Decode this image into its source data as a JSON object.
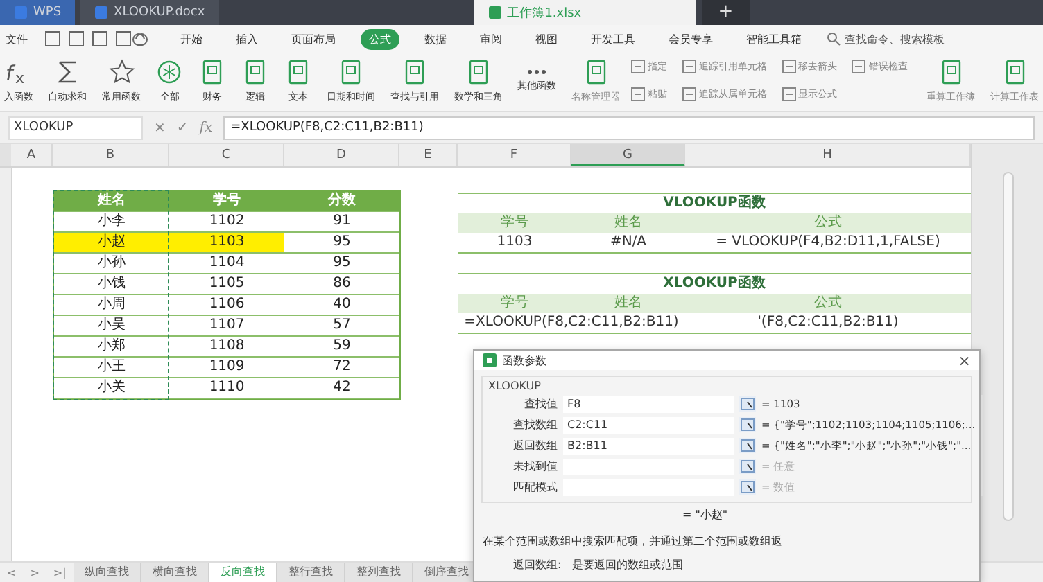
{
  "title_tabs": [
    {
      "label": "WPS",
      "selected": false
    },
    {
      "label": "XLOOKUP.docx",
      "selected": false
    },
    {
      "label": "工作簿1.xlsx",
      "selected": true
    }
  ],
  "new_tab": "+",
  "menu": {
    "file": "文件",
    "tabs": [
      {
        "label": "开始",
        "selected": false
      },
      {
        "label": "插入",
        "selected": false
      },
      {
        "label": "页面布局",
        "selected": false
      },
      {
        "label": "公式",
        "selected": true
      },
      {
        "label": "数据",
        "selected": false
      },
      {
        "label": "审阅",
        "selected": false
      },
      {
        "label": "视图",
        "selected": false
      },
      {
        "label": "开发工具",
        "selected": false
      },
      {
        "label": "会员专享",
        "selected": false
      },
      {
        "label": "智能工具箱",
        "selected": false
      }
    ],
    "search": {
      "placeholder": "查找命令、搜索模板"
    }
  },
  "ribbon": [
    {
      "label": "入函数",
      "kind": "fx",
      "disabled": false
    },
    {
      "label": "自动求和",
      "kind": "sum",
      "disabled": false
    },
    {
      "label": "常用函数",
      "kind": "star",
      "disabled": false
    },
    {
      "label": "全部",
      "kind": "circle",
      "disabled": false
    },
    {
      "label": "财务",
      "kind": "book",
      "disabled": false
    },
    {
      "label": "逻辑",
      "kind": "book",
      "disabled": false
    },
    {
      "label": "文本",
      "kind": "book",
      "disabled": false
    },
    {
      "label": "日期和时间",
      "kind": "book",
      "disabled": false
    },
    {
      "label": "查找与引用",
      "kind": "book",
      "disabled": false
    },
    {
      "label": "数学和三角",
      "kind": "book",
      "disabled": false
    },
    {
      "label": "其他函数",
      "kind": "dots",
      "disabled": false
    },
    {
      "label": "名称管理器",
      "kind": "book",
      "disabled": true
    },
    {
      "label": "指定",
      "kind": "small",
      "disabled": true
    },
    {
      "label": "粘贴",
      "kind": "small",
      "disabled": true
    },
    {
      "label": "追踪引用单元格",
      "kind": "small",
      "disabled": true
    },
    {
      "label": "追踪从属单元格",
      "kind": "small",
      "disabled": true
    },
    {
      "label": "移去箭头",
      "kind": "small",
      "disabled": true
    },
    {
      "label": "显示公式",
      "kind": "small",
      "disabled": true
    },
    {
      "label": "错误检查",
      "kind": "small",
      "disabled": true
    },
    {
      "label": "重算工作簿",
      "kind": "book",
      "disabled": true
    },
    {
      "label": "计算工作表",
      "kind": "book",
      "disabled": true
    }
  ],
  "formula_bar": {
    "name_box": "XLOOKUP",
    "cancel": "×",
    "confirm": "✓",
    "fx": "fx",
    "formula": "=XLOOKUP(F8,C2:C11,B2:B11)"
  },
  "columns": [
    {
      "label": "A",
      "selected": false
    },
    {
      "label": "B",
      "selected": false
    },
    {
      "label": "C",
      "selected": false
    },
    {
      "label": "D",
      "selected": false
    },
    {
      "label": "E",
      "selected": false
    },
    {
      "label": "F",
      "selected": false
    },
    {
      "label": "G",
      "selected": true
    },
    {
      "label": "H",
      "selected": false
    }
  ],
  "score_table": {
    "columns": [
      "姓名",
      "学号",
      "分数"
    ],
    "rows": [
      {
        "cells": [
          "小李",
          "1102",
          "91"
        ],
        "highlighted": false
      },
      {
        "cells": [
          "小赵",
          "1103",
          "95"
        ],
        "highlighted": true
      },
      {
        "cells": [
          "小孙",
          "1104",
          "95"
        ],
        "highlighted": false
      },
      {
        "cells": [
          "小钱",
          "1105",
          "86"
        ],
        "highlighted": false
      },
      {
        "cells": [
          "小周",
          "1106",
          "40"
        ],
        "highlighted": false
      },
      {
        "cells": [
          "小吴",
          "1107",
          "57"
        ],
        "highlighted": false
      },
      {
        "cells": [
          "小郑",
          "1108",
          "59"
        ],
        "highlighted": false
      },
      {
        "cells": [
          "小王",
          "1109",
          "72"
        ],
        "highlighted": false
      },
      {
        "cells": [
          "小关",
          "1110",
          "42"
        ],
        "highlighted": false
      }
    ]
  },
  "lookup_tables": [
    {
      "title": "VLOOKUP函数",
      "columns": [
        "学号",
        "姓名",
        "公式"
      ],
      "row": {
        "kind": "cells",
        "cells": [
          "1103",
          "#N/A",
          "= VLOOKUP(F4,B2:D11,1,FALSE)"
        ]
      }
    },
    {
      "title": "XLOOKUP函数",
      "columns": [
        "学号",
        "姓名",
        "公式"
      ],
      "row": {
        "kind": "spill",
        "cells": [
          "=XLOOKUP(F8,C2:C11,B2:B11)",
          "'(F8,C2:C11,B2:B11)"
        ]
      }
    }
  ],
  "sheet_nav": [
    "<",
    ">",
    ">|"
  ],
  "sheet_tabs": [
    {
      "label": "纵向查找",
      "selected": false
    },
    {
      "label": "横向查找",
      "selected": false
    },
    {
      "label": "反向查找",
      "selected": true
    },
    {
      "label": "整行查找",
      "selected": false
    },
    {
      "label": "整列查找",
      "selected": false
    },
    {
      "label": "倒序查找",
      "selected": false
    }
  ],
  "dialog": {
    "title": "函数参数",
    "close": "×",
    "function": "XLOOKUP",
    "args": [
      {
        "label": "查找值",
        "value": "F8",
        "result": "= 1103",
        "dimmed": false
      },
      {
        "label": "查找数组",
        "value": "C2:C11",
        "result": "= {\"学号\";1102;1103;1104;1105;1106;...",
        "dimmed": false
      },
      {
        "label": "返回数组",
        "value": "B2:B11",
        "result": "= {\"姓名\";\"小李\";\"小赵\";\"小孙\";\"小钱\";\"...",
        "dimmed": false
      },
      {
        "label": "未找到值",
        "result": "= 任意",
        "dimmed": true
      },
      {
        "label": "匹配模式",
        "result": "= 数值",
        "dimmed": true
      }
    ],
    "result_line": "= \"小赵\"",
    "description": "在某个范围或数组中搜索匹配项，并通过第二个范围或数组返",
    "arg_help_label": "返回数组:",
    "arg_help": "是要返回的数组或范围"
  }
}
